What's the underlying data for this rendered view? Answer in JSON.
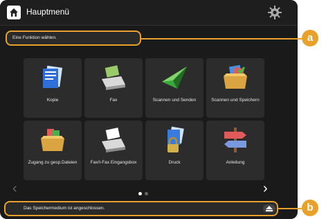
{
  "header": {
    "title": "Hauptmenü"
  },
  "message": "Eine Funktion wählen.",
  "tiles": [
    {
      "label": "Kopie",
      "icon": "copy-icon"
    },
    {
      "label": "Fax",
      "icon": "fax-icon"
    },
    {
      "label": "Scannen und Senden",
      "icon": "scan-send-icon"
    },
    {
      "label": "Scannen und Speichern",
      "icon": "scan-store-icon"
    },
    {
      "label": "Zugang zu gesp.Dateien",
      "icon": "stored-files-icon"
    },
    {
      "label": "Fax/I-Fax Eingangsbox",
      "icon": "fax-inbox-icon"
    },
    {
      "label": "Druck",
      "icon": "print-icon"
    },
    {
      "label": "Anleitung",
      "icon": "guide-icon"
    }
  ],
  "nav": {
    "prev": "‹",
    "next": "›",
    "page": 1,
    "pages": 2
  },
  "status": "Das Speichermedium ist angeschlossen.",
  "callouts": {
    "a": "a",
    "b": "b"
  },
  "colors": {
    "accent": "#e8a12b",
    "background": "#1a1a1a",
    "tile": "#2c2c2c"
  }
}
